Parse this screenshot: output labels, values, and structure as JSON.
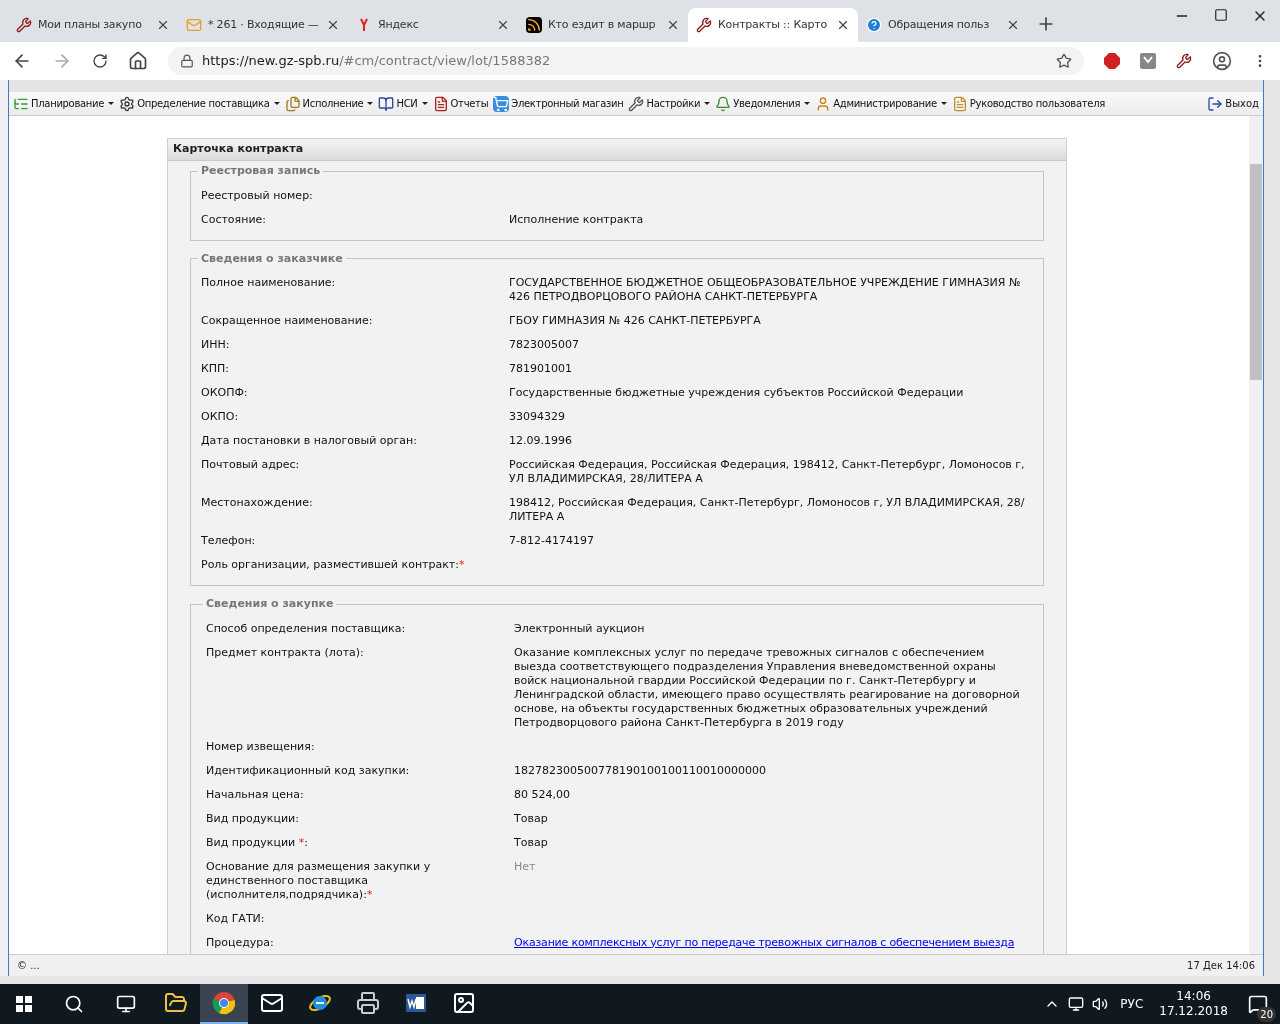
{
  "browser": {
    "tabs": [
      {
        "title": "Мои планы закупо",
        "kind": "tools",
        "selected": false
      },
      {
        "title": "* 261 · Входящие —",
        "kind": "mail",
        "selected": false
      },
      {
        "title": "Яндекс",
        "kind": "yandex",
        "selected": false
      },
      {
        "title": "Кто ездит в маршр",
        "kind": "rss",
        "selected": false
      },
      {
        "title": "Контракты :: Карто",
        "kind": "tools",
        "selected": true
      },
      {
        "title": "Обращения польз",
        "kind": "help",
        "selected": false
      }
    ],
    "url_host": "https://new.gz-spb.ru",
    "url_path": "/#cm/contract/view/lot/1588382"
  },
  "menu": [
    {
      "label": "Планирование",
      "kind": "plan",
      "has_menu": true
    },
    {
      "label": "Определение поставщика",
      "kind": "gear",
      "has_menu": true
    },
    {
      "label": "Исполнение",
      "kind": "docs",
      "has_menu": true
    },
    {
      "label": "НСИ",
      "kind": "book",
      "has_menu": true
    },
    {
      "label": "Отчеты",
      "kind": "report",
      "has_menu": false
    },
    {
      "label": "Электронный магазин",
      "kind": "cart",
      "has_menu": false
    },
    {
      "label": "Настройки",
      "kind": "wrench",
      "has_menu": true
    },
    {
      "label": "Уведомления",
      "kind": "notify",
      "has_menu": true
    },
    {
      "label": "Администрирование",
      "kind": "user",
      "has_menu": true
    },
    {
      "label": "Руководство пользователя",
      "kind": "manual",
      "has_menu": false
    }
  ],
  "logout": "Выход",
  "card": {
    "title": "Карточка контракта",
    "sections": [
      {
        "title": "Реестровая запись",
        "rows": [
          {
            "label": "Реестровый номер:"
          },
          {
            "label": "Состояние:",
            "value": "Исполнение контракта"
          }
        ]
      },
      {
        "title": "Сведения о заказчике",
        "rows": [
          {
            "label": "Полное наименование:",
            "value": "ГОСУДАРСТВЕННОЕ БЮДЖЕТНОЕ ОБЩЕОБРАЗОВАТЕЛЬНОЕ УЧРЕЖДЕНИЕ ГИМНАЗИЯ № 426 ПЕТРОДВОРЦОВОГО РАЙОНА САНКТ-ПЕТЕРБУРГА"
          },
          {
            "label": "Сокращенное наименование:",
            "value": "ГБОУ ГИМНАЗИЯ № 426 САНКТ-ПЕТЕРБУРГА"
          },
          {
            "label": "ИНН:",
            "value": "7823005007"
          },
          {
            "label": "КПП:",
            "value": "781901001"
          },
          {
            "label": "ОКОПФ:",
            "value": "Государственные бюджетные учреждения субъектов Российской Федерации"
          },
          {
            "label": "ОКПО:",
            "value": "33094329"
          },
          {
            "label": "Дата постановки в налоговый орган:",
            "value": "12.09.1996"
          },
          {
            "label": "Почтовый адрес:",
            "value": "Российская Федерация, Российская Федерация, 198412, Санкт-Петербург, Ломоносов г, УЛ ВЛАДИМИРСКАЯ, 28/ЛИТЕРА А"
          },
          {
            "label": "Местонахождение:",
            "value": "198412, Российская Федерация, Санкт-Петербург, Ломоносов г, УЛ ВЛАДИМИРСКАЯ, 28/ЛИТЕРА А"
          },
          {
            "label": "Телефон:",
            "value": "7-812-4174197"
          },
          {
            "label": "Роль организации, разместившей контракт:",
            "required": "*"
          }
        ]
      },
      {
        "title": "Сведения о закупке",
        "rows": [
          {
            "label": "Способ определения поставщика:",
            "value": "Электронный аукцион"
          },
          {
            "label": "Предмет контракта (лота):",
            "value": "Оказание комплексных услуг по передаче тревожных сигналов с обеспечением выезда соответствующего подразделения Управления вневедомственной охраны войск национальной гвардии Российской Федерации по г. Санкт-Петербургу и Ленинградской области, имеющего право осуществлять реагирование на договорной основе, на объекты государственных бюджетных образовательных учреждений Петродворцового района Санкт-Петербурга в 2019 году"
          },
          {
            "label": "Номер извещения:"
          },
          {
            "label": "Идентификационный код закупки:",
            "value": "182782300500778190100100110010000000"
          },
          {
            "label": "Начальная цена:",
            "value": "80 524,00"
          },
          {
            "label": "Вид продукции:",
            "value": "Товар"
          },
          {
            "label": "Вид продукции ",
            "required": "*",
            "suffix": ":",
            "value": "Товар"
          },
          {
            "label": "Основание для размещения закупки у единственного поставщика (исполнителя,подрядчика):",
            "required": "*",
            "value": "Нет",
            "muted": true
          },
          {
            "label": "Код ГАТИ:"
          },
          {
            "label": "Процедура:",
            "value": "Оказание комплексных услуг по передаче тревожных сигналов с обеспечением выезда",
            "link": true
          }
        ]
      }
    ]
  },
  "status": {
    "left": "© ...",
    "right": "17 Дек 14:06"
  },
  "taskbar": {
    "apps": [
      {
        "kind": "explorer",
        "selected": false
      },
      {
        "kind": "chrome",
        "selected": true
      },
      {
        "kind": "mail",
        "selected": false
      },
      {
        "kind": "ie",
        "selected": false
      },
      {
        "kind": "printer",
        "selected": false
      },
      {
        "kind": "word",
        "selected": false
      },
      {
        "kind": "photos",
        "selected": false
      }
    ],
    "lang": "РУС",
    "time": "14:06",
    "date": "17.12.2018",
    "notifications": "20"
  }
}
